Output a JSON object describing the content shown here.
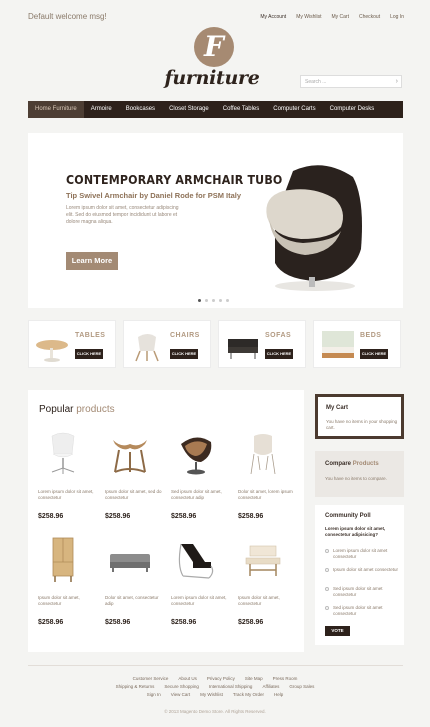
{
  "header": {
    "welcome": "Default welcome msg!",
    "links": [
      "My Account",
      "My Wishlist",
      "My Cart",
      "Checkout",
      "Log In"
    ],
    "logo_letter": "F",
    "logo_text": "furniture",
    "search_placeholder": "Search ..."
  },
  "nav": [
    "Home Furniture",
    "Armoire",
    "Bookcases",
    "Closet Storage",
    "Coffee Tables",
    "Computer Carts",
    "Computer Desks"
  ],
  "slider": {
    "title": "Contemporary Armchair Tubo",
    "subtitle": "Tip Swivel Armchair by Daniel Rode for PSM Italy",
    "description": "Lorem ipsum dolor sit amet, consectetur adipiscing elit. Sed do eiusmod tempor incididunt ut labore et dolore magna aliqua.",
    "button": "Learn More",
    "slide_count": 5,
    "active_slide": 1
  },
  "categories": [
    {
      "name": "Tables",
      "button": "CLICK HERE"
    },
    {
      "name": "Chairs",
      "button": "CLICK HERE"
    },
    {
      "name": "Sofas",
      "button": "CLICK HERE"
    },
    {
      "name": "Beds",
      "button": "CLICK HERE"
    }
  ],
  "products": {
    "title_a": "Popular",
    "title_b": "products",
    "items": [
      {
        "desc": "Lorem ipsum dolor sit amet, consectetur",
        "price": "$258.96"
      },
      {
        "desc": "Ipsum dolor sit amet, sed do consectetur",
        "price": "$258.96"
      },
      {
        "desc": "Sed ipsum dolor sit amet, consectetur adip",
        "price": "$258.96"
      },
      {
        "desc": "Dolor sit amet, lorem ipsum consectetur",
        "price": "$258.96"
      },
      {
        "desc": "Ipsum dolor sit amet, consectetur",
        "price": "$258.96"
      },
      {
        "desc": "Dolor sit amet, consectetur adip",
        "price": "$258.96"
      },
      {
        "desc": "Lorem ipsum dolor sit amet, consectetur",
        "price": "$258.96"
      },
      {
        "desc": "Ipsum dolor sit amet, consectetur",
        "price": "$258.96"
      }
    ]
  },
  "sidebar": {
    "cart_title": "My Cart",
    "cart_text": "You have no items in your shopping cart.",
    "compare_a": "Compare",
    "compare_b": "Products",
    "compare_text": "You have no items to compare.",
    "poll_title": "Community Poll",
    "poll_question": "Lorem ipsum dolor sit amet, consectetur adipisicing?",
    "poll_options": [
      "Lorem ipsum dolor sit amet consectetur",
      "Ipsum dolor sit amet consectetur",
      "Sed ipsum dolor sit amet consectetur",
      "Sed ipsum dolor sit amet consectetur"
    ],
    "vote": "VOTE"
  },
  "footer": {
    "row1": [
      "Customer Service",
      "About Us",
      "Privacy Policy",
      "Site Map",
      "Press Room"
    ],
    "row2": [
      "Shipping & Returns",
      "Secure Shopping",
      "International Shipping",
      "Affiliates",
      "Group Sales"
    ],
    "row3": [
      "Sign In",
      "View Cart",
      "My Wishlist",
      "Track My Order",
      "Help"
    ],
    "copyright": "© 2013 Magento Demo Store. All Rights Reserved."
  }
}
